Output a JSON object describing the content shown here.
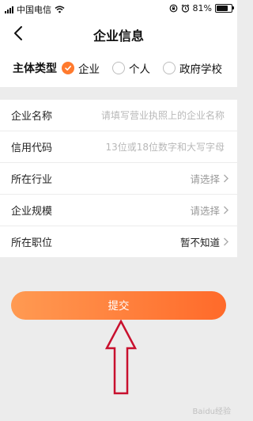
{
  "status": {
    "carrier": "中国电信",
    "battery": "81%",
    "battery_level": 0.81
  },
  "header": {
    "title": "企业信息"
  },
  "entity_type": {
    "label": "主体类型",
    "options": [
      {
        "label": "企业",
        "selected": true
      },
      {
        "label": "个人",
        "selected": false
      },
      {
        "label": "政府学校",
        "selected": false
      }
    ]
  },
  "form": {
    "fields": [
      {
        "label": "企业名称",
        "placeholder": "请填写营业执照上的企业名称"
      },
      {
        "label": "信用代码",
        "placeholder": "13位或18位数字和大写字母"
      },
      {
        "label": "所在行业",
        "value": "请选择"
      },
      {
        "label": "企业规模",
        "value": "请选择"
      },
      {
        "label": "所在职位",
        "value": "暂不知道"
      }
    ]
  },
  "submit": {
    "label": "提交"
  },
  "watermark": "Baidu经验",
  "colors": {
    "accent": "#ff7a2e",
    "arrow": "#c8102e"
  }
}
